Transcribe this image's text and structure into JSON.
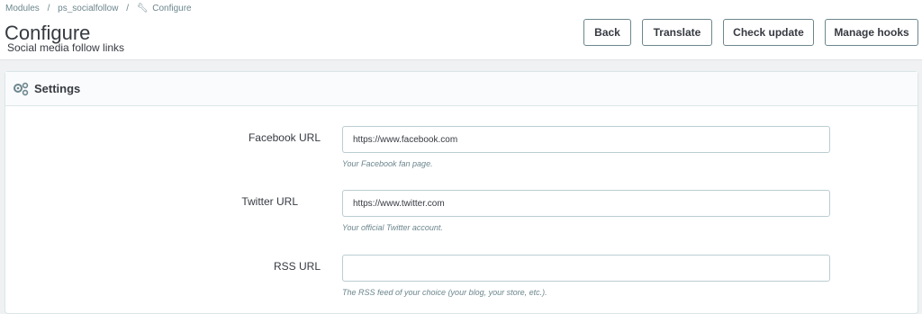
{
  "breadcrumb": {
    "items": [
      "Modules",
      "ps_socialfollow",
      "Configure"
    ]
  },
  "page": {
    "title": "Configure",
    "subtitle": "Social media follow links"
  },
  "toolbar": {
    "back_label": "Back",
    "translate_label": "Translate",
    "check_update_label": "Check update",
    "manage_hooks_label": "Manage hooks"
  },
  "panel": {
    "heading": "Settings",
    "icon": "gears-icon"
  },
  "fields": [
    {
      "label": "Facebook URL",
      "value": "https://www.facebook.com",
      "help": "Your Facebook fan page."
    },
    {
      "label": "Twitter URL",
      "value": "https://www.twitter.com",
      "help": "Your official Twitter account."
    },
    {
      "label": "RSS URL",
      "value": "",
      "help": "The RSS feed of your choice (your blog, your store, etc.)."
    }
  ],
  "colors": {
    "accent": "#25b9d7",
    "text": "#363a41",
    "muted": "#6c868e",
    "background": "#eff1f2"
  }
}
